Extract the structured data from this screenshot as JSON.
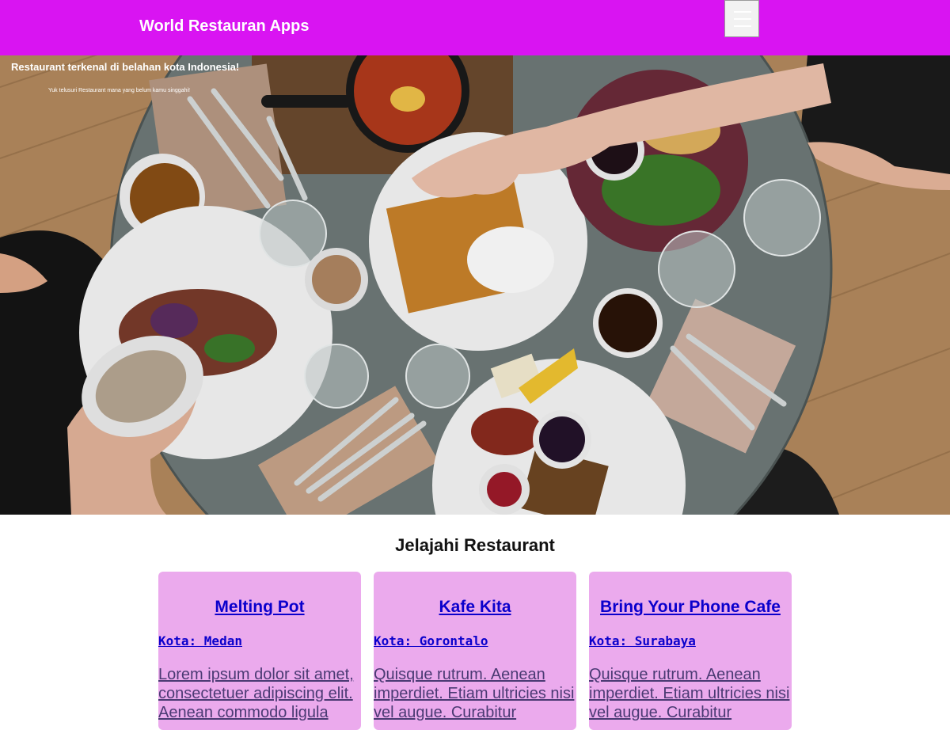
{
  "header": {
    "title": "World Restauran Apps",
    "menu_icon": "hamburger-icon",
    "colors": {
      "background": "#d914f2",
      "text": "#ffffff"
    }
  },
  "hero": {
    "title": "Restaurant terkenal di belahan kota Indonesia!",
    "subtitle": "Yuk telusuri Restaurant mana yang belum kamu singgahi!"
  },
  "explore": {
    "title": "Jelajahi Restaurant",
    "restaurants": [
      {
        "name": "Melting Pot",
        "city": "Kota: Medan",
        "description": "Lorem ipsum dolor sit amet, consectetuer adipiscing elit. Aenean commodo ligula"
      },
      {
        "name": "Kafe Kita",
        "city": "Kota: Gorontalo",
        "description": "Quisque rutrum. Aenean imperdiet. Etiam ultricies nisi vel augue. Curabitur"
      },
      {
        "name": "Bring Your Phone Cafe",
        "city": "Kota: Surabaya",
        "description": "Quisque rutrum. Aenean imperdiet. Etiam ultricies nisi vel augue. Curabitur"
      }
    ],
    "colors": {
      "card_background": "#ebaaed",
      "link": "#0b00cc"
    }
  }
}
